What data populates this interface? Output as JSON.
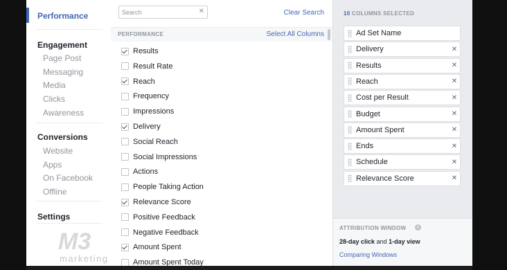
{
  "nav": {
    "items": [
      {
        "label": "Performance",
        "kind": "active"
      },
      {
        "label": "Engagement",
        "kind": "head"
      },
      {
        "label": "Page Post",
        "kind": "sub"
      },
      {
        "label": "Messaging",
        "kind": "sub"
      },
      {
        "label": "Media",
        "kind": "sub"
      },
      {
        "label": "Clicks",
        "kind": "sub"
      },
      {
        "label": "Awareness",
        "kind": "sub"
      },
      {
        "label": "Conversions",
        "kind": "head"
      },
      {
        "label": "Website",
        "kind": "sub"
      },
      {
        "label": "Apps",
        "kind": "sub"
      },
      {
        "label": "On Facebook",
        "kind": "sub"
      },
      {
        "label": "Offline",
        "kind": "sub"
      },
      {
        "label": "Settings",
        "kind": "head"
      }
    ]
  },
  "search": {
    "placeholder": "Search",
    "value": "",
    "clear_icon": "close-icon"
  },
  "clear_search_label": "Clear Search",
  "section": {
    "label": "PERFORMANCE",
    "select_all_label": "Select All Columns"
  },
  "columns": [
    {
      "label": "Results",
      "checked": true
    },
    {
      "label": "Result Rate",
      "checked": false
    },
    {
      "label": "Reach",
      "checked": true
    },
    {
      "label": "Frequency",
      "checked": false
    },
    {
      "label": "Impressions",
      "checked": false
    },
    {
      "label": "Delivery",
      "checked": true
    },
    {
      "label": "Social Reach",
      "checked": false
    },
    {
      "label": "Social Impressions",
      "checked": false
    },
    {
      "label": "Actions",
      "checked": false
    },
    {
      "label": "People Taking Action",
      "checked": false
    },
    {
      "label": "Relevance Score",
      "checked": true
    },
    {
      "label": "Positive Feedback",
      "checked": false
    },
    {
      "label": "Negative Feedback",
      "checked": false
    },
    {
      "label": "Amount Spent",
      "checked": true
    },
    {
      "label": "Amount Spent Today",
      "checked": false
    }
  ],
  "selected": {
    "count": "10",
    "title": "COLUMNS SELECTED",
    "items": [
      {
        "label": "Ad Set Name",
        "removable": false
      },
      {
        "label": "Delivery",
        "removable": true
      },
      {
        "label": "Results",
        "removable": true
      },
      {
        "label": "Reach",
        "removable": true
      },
      {
        "label": "Cost per Result",
        "removable": true
      },
      {
        "label": "Budget",
        "removable": true
      },
      {
        "label": "Amount Spent",
        "removable": true
      },
      {
        "label": "Ends",
        "removable": true
      },
      {
        "label": "Schedule",
        "removable": true
      },
      {
        "label": "Relevance Score",
        "removable": true
      }
    ]
  },
  "attribution": {
    "title": "ATTRIBUTION WINDOW",
    "desc_part1": "28-day click",
    "desc_part2": " and ",
    "desc_part3": "1-day view",
    "link": "Comparing Windows"
  },
  "watermark": {
    "logo_text": "M3",
    "sub_text": "marketing"
  },
  "colors": {
    "accent": "#4267b2",
    "muted": "#90949c",
    "panel": "#e9ebee"
  }
}
